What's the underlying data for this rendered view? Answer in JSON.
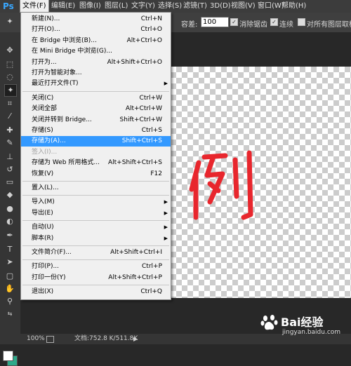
{
  "app": {
    "logo": "Ps"
  },
  "menubar": [
    {
      "label": "文件(F)",
      "active": true
    },
    {
      "label": "编辑(E)"
    },
    {
      "label": "图像(I)"
    },
    {
      "label": "图层(L)"
    },
    {
      "label": "文字(Y)"
    },
    {
      "label": "选择(S)"
    },
    {
      "label": "滤镜(T)"
    },
    {
      "label": "3D(D)"
    },
    {
      "label": "视图(V)"
    },
    {
      "label": "窗口(W)"
    },
    {
      "label": "帮助(H)"
    }
  ],
  "options": {
    "tolerance_label": "容差:",
    "tolerance_value": "100",
    "antialias_label": "消除锯齿",
    "contiguous_label": "连续",
    "all_layers_label": "对所有图层取样"
  },
  "file_menu": [
    {
      "label": "新建(N)...",
      "shortcut": "Ctrl+N"
    },
    {
      "label": "打开(O)...",
      "shortcut": "Ctrl+O"
    },
    {
      "label": "在 Bridge 中浏览(B)...",
      "shortcut": "Alt+Ctrl+O"
    },
    {
      "label": "在 Mini Bridge 中浏览(G)...",
      "shortcut": ""
    },
    {
      "label": "打开为...",
      "shortcut": "Alt+Shift+Ctrl+O"
    },
    {
      "label": "打开为智能对象...",
      "shortcut": ""
    },
    {
      "label": "最近打开文件(T)",
      "shortcut": "",
      "submenu": true
    },
    {
      "separator": true
    },
    {
      "label": "关闭(C)",
      "shortcut": "Ctrl+W"
    },
    {
      "label": "关闭全部",
      "shortcut": "Alt+Ctrl+W"
    },
    {
      "label": "关闭并转到 Bridge...",
      "shortcut": "Shift+Ctrl+W"
    },
    {
      "label": "存储(S)",
      "shortcut": "Ctrl+S"
    },
    {
      "label": "存储为(A)...",
      "shortcut": "Shift+Ctrl+S",
      "highlight": true
    },
    {
      "label": "签入(I)...",
      "shortcut": "",
      "disabled": true
    },
    {
      "label": "存储为 Web 所用格式...",
      "shortcut": "Alt+Shift+Ctrl+S"
    },
    {
      "label": "恢复(V)",
      "shortcut": "F12"
    },
    {
      "separator": true
    },
    {
      "label": "置入(L)...",
      "shortcut": ""
    },
    {
      "separator": true
    },
    {
      "label": "导入(M)",
      "shortcut": "",
      "submenu": true
    },
    {
      "label": "导出(E)",
      "shortcut": "",
      "submenu": true
    },
    {
      "separator": true
    },
    {
      "label": "自动(U)",
      "shortcut": "",
      "submenu": true
    },
    {
      "label": "脚本(R)",
      "shortcut": "",
      "submenu": true
    },
    {
      "separator": true
    },
    {
      "label": "文件简介(F)...",
      "shortcut": "Alt+Shift+Ctrl+I"
    },
    {
      "separator": true
    },
    {
      "label": "打印(P)...",
      "shortcut": "Ctrl+P"
    },
    {
      "label": "打印一份(Y)",
      "shortcut": "Alt+Shift+Ctrl+P"
    },
    {
      "separator": true
    },
    {
      "label": "退出(X)",
      "shortcut": "Ctrl+Q"
    }
  ],
  "status": {
    "zoom": "100%",
    "doc_info": "文档:752.8 K/511.8K"
  },
  "watermark": {
    "brand": "Bai",
    "brand2": "经验",
    "url": "jingyan.baidu.com"
  },
  "colors": {
    "foreground": "#ffffff",
    "background": "#2ea98a",
    "stroke": "#e8262d",
    "highlight": "#3399ff"
  }
}
